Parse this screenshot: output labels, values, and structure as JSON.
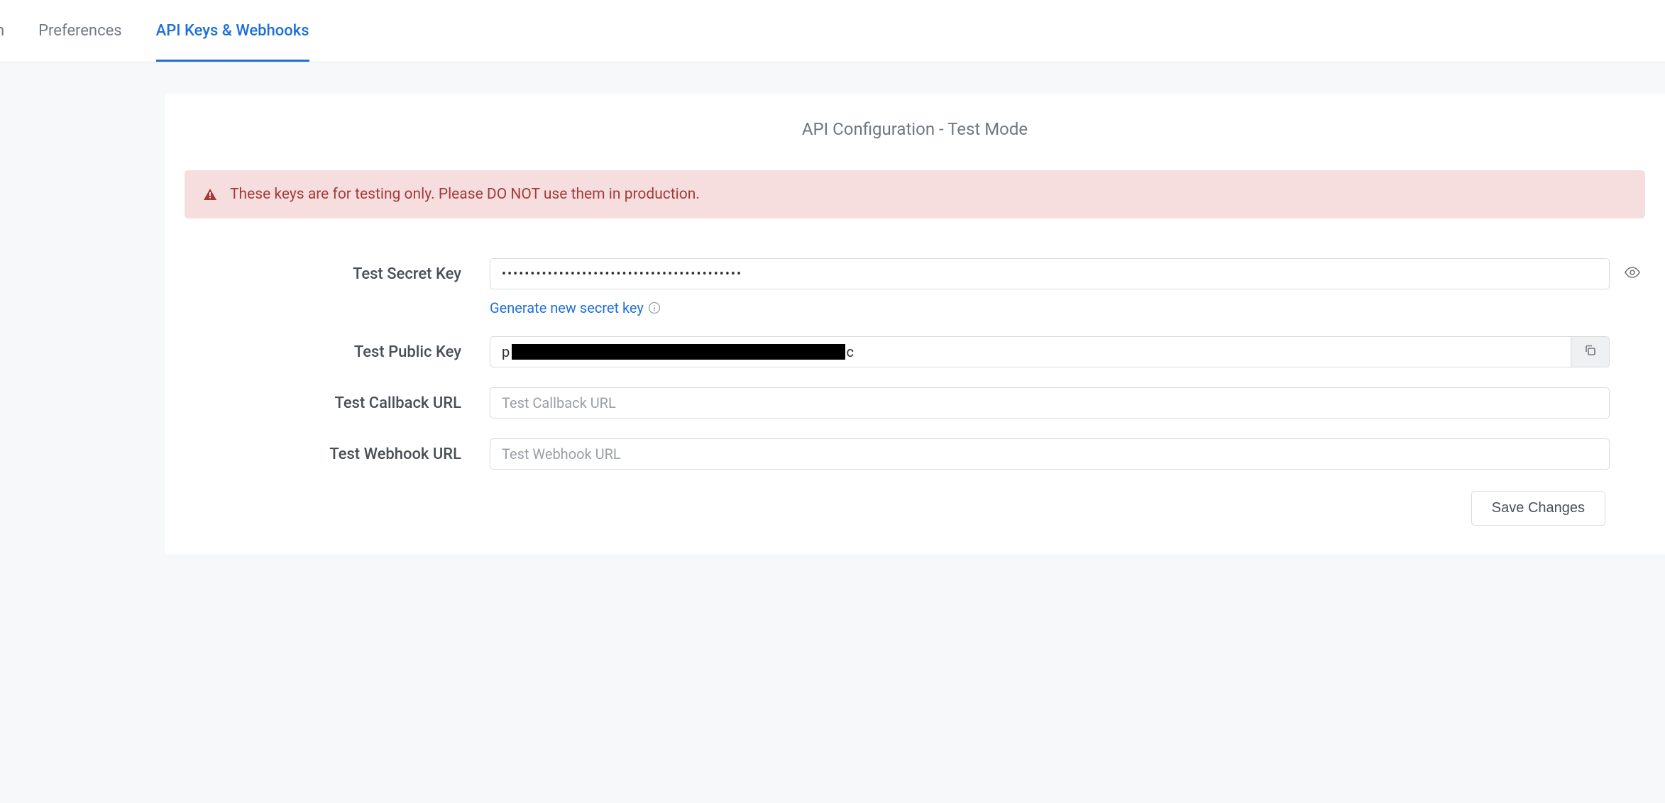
{
  "tabs": {
    "partial": "n",
    "preferences": "Preferences",
    "api_keys": "API Keys & Webhooks"
  },
  "card": {
    "title": "API Configuration - Test Mode"
  },
  "alert": {
    "message": "These keys are for testing only. Please DO NOT use them in production."
  },
  "form": {
    "secret": {
      "label": "Test Secret Key",
      "value": "••••••••••••••••••••••••••••••••••••••••••"
    },
    "generate_link": "Generate new secret key",
    "public": {
      "label": "Test Public Key",
      "prefix": "p",
      "suffix": "c"
    },
    "callback": {
      "label": "Test Callback URL",
      "placeholder": "Test Callback URL",
      "value": ""
    },
    "webhook": {
      "label": "Test Webhook URL",
      "placeholder": "Test Webhook URL",
      "value": ""
    }
  },
  "actions": {
    "save": "Save Changes"
  },
  "icons": {
    "warning": "warning-icon",
    "eye": "eye-icon",
    "copy": "copy-icon",
    "info": "info-icon"
  }
}
